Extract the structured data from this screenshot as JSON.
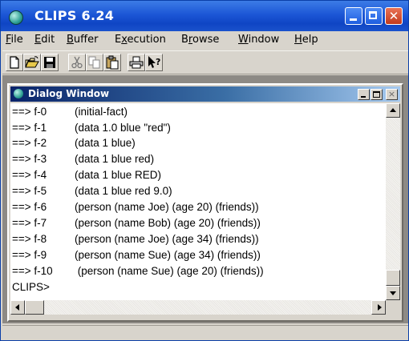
{
  "window": {
    "title": "CLIPS 6.24",
    "icon": "clips-app-icon",
    "controls": [
      "minimize-icon",
      "maximize-icon",
      "close-icon"
    ],
    "close_glyph": "✕"
  },
  "menubar": [
    {
      "pre": "",
      "u": "F",
      "post": "ile"
    },
    {
      "pre": "",
      "u": "E",
      "post": "dit"
    },
    {
      "pre": "",
      "u": "B",
      "post": "uffer"
    },
    {
      "pre": "E",
      "u": "x",
      "post": "ecution"
    },
    {
      "pre": "B",
      "u": "r",
      "post": "owse"
    },
    {
      "pre": "",
      "u": "W",
      "post": "indow"
    },
    {
      "pre": "",
      "u": "H",
      "post": "elp"
    }
  ],
  "toolbar": [
    "new-file-icon",
    "open-folder-icon",
    "save-icon",
    "cut-icon",
    "copy-icon",
    "paste-icon",
    "print-icon",
    "context-help-icon"
  ],
  "dialog": {
    "title": "Dialog Window",
    "close_glyph": "×",
    "lines": [
      {
        "id": "==> f-0",
        "fact": "(initial-fact)"
      },
      {
        "id": "==> f-1",
        "fact": "(data 1.0 blue \"red\")"
      },
      {
        "id": "==> f-2",
        "fact": "(data 1 blue)"
      },
      {
        "id": "==> f-3",
        "fact": "(data 1 blue red)"
      },
      {
        "id": "==> f-4",
        "fact": "(data 1 blue RED)"
      },
      {
        "id": "==> f-5",
        "fact": "(data 1 blue red 9.0)"
      },
      {
        "id": "==> f-6",
        "fact": "(person (name Joe) (age 20) (friends))"
      },
      {
        "id": "==> f-7",
        "fact": "(person (name Bob) (age 20) (friends))"
      },
      {
        "id": "==> f-8",
        "fact": "(person (name Joe) (age 34) (friends))"
      },
      {
        "id": "==> f-9",
        "fact": "(person (name Sue) (age 34) (friends))"
      },
      {
        "id": "==> f-10",
        "fact": " (person (name Sue) (age 20) (friends))"
      }
    ],
    "prompt": "CLIPS>"
  }
}
